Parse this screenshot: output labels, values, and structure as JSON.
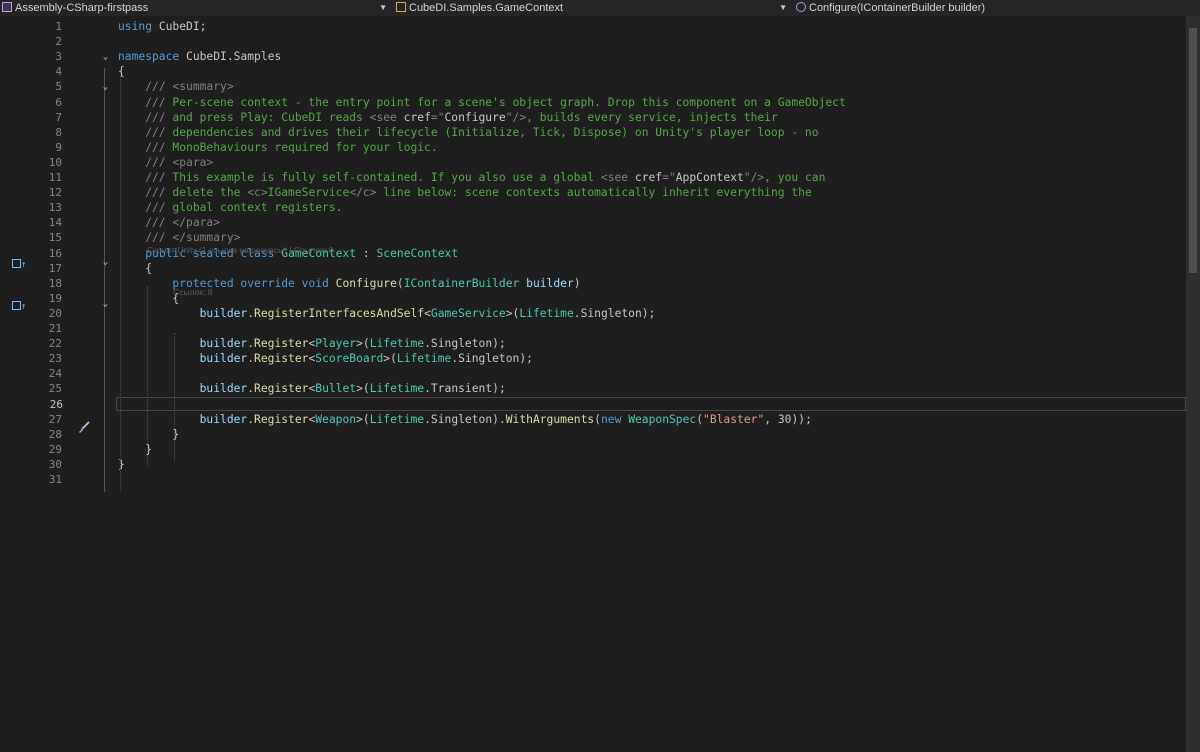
{
  "navigation_bar": {
    "project": "Assembly-CSharp-firstpass",
    "type_scope": "CubeDI.Samples.GameContext",
    "member_scope": "Configure(IContainerBuilder builder)"
  },
  "code_lens": {
    "class_refs": "Скрипт Unity (1 ссылка на ресурсы) | Ссылок: 0",
    "method_refs": "Ссылок: 8"
  },
  "editor": {
    "current_line": 26,
    "lines": [
      {
        "n": "1",
        "t": [
          [
            "kw",
            "using"
          ],
          [
            "tx",
            " CubeDI;"
          ]
        ]
      },
      {
        "n": "2",
        "t": []
      },
      {
        "n": "3",
        "t": [
          [
            "kw",
            "namespace"
          ],
          [
            "tx",
            " CubeDI.Samples"
          ]
        ]
      },
      {
        "n": "4",
        "t": [
          [
            "tx",
            "{"
          ]
        ]
      },
      {
        "n": "5",
        "t": [
          [
            "cm",
            "    "
          ],
          [
            "xm",
            "/// <summary>"
          ]
        ]
      },
      {
        "n": "6",
        "t": [
          [
            "xm",
            "    ///"
          ],
          [
            "cm",
            " Per-scene context - the entry point for a scene's object graph. Drop this component on a GameObject"
          ]
        ]
      },
      {
        "n": "7",
        "t": [
          [
            "xm",
            "    ///"
          ],
          [
            "cm",
            " and press Play: CubeDI reads "
          ],
          [
            "xm",
            "<see "
          ],
          [
            "tx",
            "cref"
          ],
          [
            "xm",
            "=\""
          ],
          [
            "tx",
            "Configure"
          ],
          [
            "xm",
            "\"/>"
          ],
          [
            "cm",
            ", builds every service, injects their"
          ]
        ]
      },
      {
        "n": "8",
        "t": [
          [
            "xm",
            "    ///"
          ],
          [
            "cm",
            " dependencies and drives their lifecycle (Initialize, Tick, Dispose) on Unity's player loop - no"
          ]
        ]
      },
      {
        "n": "9",
        "t": [
          [
            "xm",
            "    ///"
          ],
          [
            "cm",
            " MonoBehaviours required for your logic."
          ]
        ]
      },
      {
        "n": "10",
        "t": [
          [
            "xm",
            "    /// <para>"
          ]
        ]
      },
      {
        "n": "11",
        "t": [
          [
            "xm",
            "    ///"
          ],
          [
            "cm",
            " This example is fully self-contained. If you also use a global "
          ],
          [
            "xm",
            "<see "
          ],
          [
            "tx",
            "cref"
          ],
          [
            "xm",
            "=\""
          ],
          [
            "tx",
            "AppContext"
          ],
          [
            "xm",
            "\"/>"
          ],
          [
            "cm",
            ", you can"
          ]
        ]
      },
      {
        "n": "12",
        "t": [
          [
            "xm",
            "    ///"
          ],
          [
            "cm",
            " delete the "
          ],
          [
            "xm",
            "<c>"
          ],
          [
            "cm",
            "IGameService"
          ],
          [
            "xm",
            "</c>"
          ],
          [
            "cm",
            " line below: scene contexts automatically inherit everything the"
          ]
        ]
      },
      {
        "n": "13",
        "t": [
          [
            "xm",
            "    ///"
          ],
          [
            "cm",
            " global context registers."
          ]
        ]
      },
      {
        "n": "14",
        "t": [
          [
            "xm",
            "    /// </para>"
          ]
        ]
      },
      {
        "n": "15",
        "t": [
          [
            "xm",
            "    /// </summary>"
          ]
        ]
      },
      {
        "n": "16",
        "t": [
          [
            "tx",
            "    "
          ],
          [
            "kw",
            "public sealed class"
          ],
          [
            "tx",
            " "
          ],
          [
            "ty",
            "GameContext"
          ],
          [
            "tx",
            " : "
          ],
          [
            "ty",
            "SceneContext"
          ]
        ]
      },
      {
        "n": "17",
        "t": [
          [
            "tx",
            "    {"
          ]
        ]
      },
      {
        "n": "18",
        "t": [
          [
            "tx",
            "        "
          ],
          [
            "kw",
            "protected override void"
          ],
          [
            "tx",
            " "
          ],
          [
            "fn",
            "Configure"
          ],
          [
            "tx",
            "("
          ],
          [
            "ty",
            "IContainerBuilder"
          ],
          [
            "tx",
            " "
          ],
          [
            "id",
            "builder"
          ],
          [
            "tx",
            ")"
          ]
        ]
      },
      {
        "n": "19",
        "t": [
          [
            "tx",
            "        {"
          ]
        ]
      },
      {
        "n": "20",
        "t": [
          [
            "tx",
            "            "
          ],
          [
            "id",
            "builder"
          ],
          [
            "tx",
            "."
          ],
          [
            "fn",
            "RegisterInterfacesAndSelf"
          ],
          [
            "tx",
            "<"
          ],
          [
            "ty",
            "GameService"
          ],
          [
            "tx",
            ">("
          ],
          [
            "ty",
            "Lifetime"
          ],
          [
            "tx",
            ".Singleton);"
          ]
        ]
      },
      {
        "n": "21",
        "t": []
      },
      {
        "n": "22",
        "t": [
          [
            "tx",
            "            "
          ],
          [
            "id",
            "builder"
          ],
          [
            "tx",
            "."
          ],
          [
            "fn",
            "Register"
          ],
          [
            "tx",
            "<"
          ],
          [
            "ty",
            "Player"
          ],
          [
            "tx",
            ">("
          ],
          [
            "ty",
            "Lifetime"
          ],
          [
            "tx",
            ".Singleton);"
          ]
        ]
      },
      {
        "n": "23",
        "t": [
          [
            "tx",
            "            "
          ],
          [
            "id",
            "builder"
          ],
          [
            "tx",
            "."
          ],
          [
            "fn",
            "Register"
          ],
          [
            "tx",
            "<"
          ],
          [
            "ty",
            "ScoreBoard"
          ],
          [
            "tx",
            ">("
          ],
          [
            "ty",
            "Lifetime"
          ],
          [
            "tx",
            ".Singleton);"
          ]
        ]
      },
      {
        "n": "24",
        "t": []
      },
      {
        "n": "25",
        "t": [
          [
            "tx",
            "            "
          ],
          [
            "id",
            "builder"
          ],
          [
            "tx",
            "."
          ],
          [
            "fn",
            "Register"
          ],
          [
            "tx",
            "<"
          ],
          [
            "ty",
            "Bullet"
          ],
          [
            "tx",
            ">("
          ],
          [
            "ty",
            "Lifetime"
          ],
          [
            "tx",
            ".Transient);"
          ]
        ]
      },
      {
        "n": "26",
        "t": []
      },
      {
        "n": "27",
        "t": [
          [
            "tx",
            "            "
          ],
          [
            "id",
            "builder"
          ],
          [
            "tx",
            "."
          ],
          [
            "fn",
            "Register"
          ],
          [
            "tx",
            "<"
          ],
          [
            "ty",
            "Weapon"
          ],
          [
            "tx",
            ">("
          ],
          [
            "ty",
            "Lifetime"
          ],
          [
            "tx",
            ".Singleton)."
          ],
          [
            "fn",
            "WithArguments"
          ],
          [
            "tx",
            "("
          ],
          [
            "kw",
            "new"
          ],
          [
            "tx",
            " "
          ],
          [
            "ty",
            "WeaponSpec"
          ],
          [
            "tx",
            "("
          ],
          [
            "st",
            "\"Blaster\""
          ],
          [
            "tx",
            ", "
          ],
          [
            "nu",
            "30"
          ],
          [
            "tx",
            "));"
          ]
        ]
      },
      {
        "n": "28",
        "t": [
          [
            "tx",
            "        }"
          ]
        ]
      },
      {
        "n": "29",
        "t": [
          [
            "tx",
            "    }"
          ]
        ]
      },
      {
        "n": "30",
        "t": [
          [
            "tx",
            "}"
          ]
        ]
      },
      {
        "n": "31",
        "t": []
      }
    ]
  }
}
